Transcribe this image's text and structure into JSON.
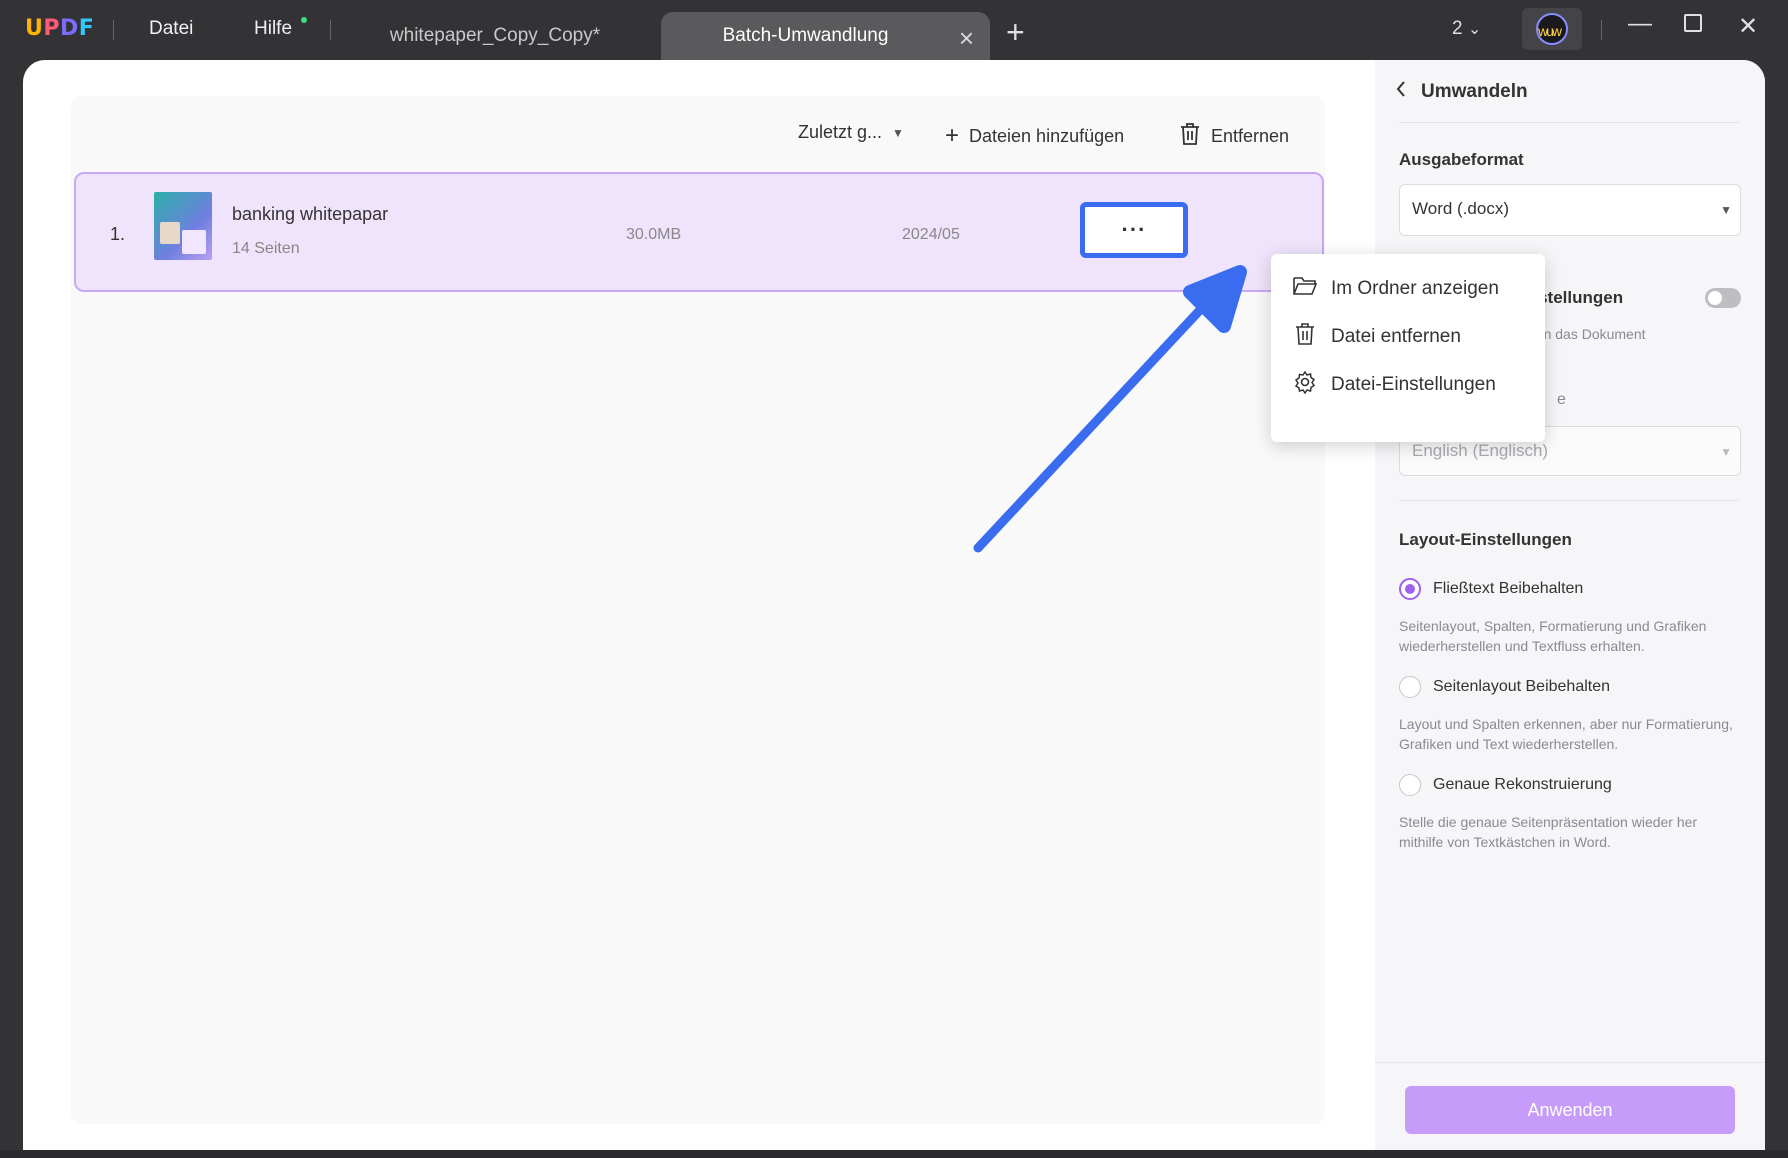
{
  "titlebar": {
    "logo": "UPDF",
    "menus": [
      "Datei",
      "Hilfe"
    ],
    "tabs": [
      {
        "label": "whitepaper_Copy_Copy*"
      },
      {
        "label": "Batch-Umwandlung"
      }
    ],
    "window_count": "2"
  },
  "toolbar": {
    "sort_label": "Zuletzt g...",
    "add_label": "Dateien hinzufügen",
    "remove_label": "Entfernen"
  },
  "file": {
    "index": "1.",
    "name": "banking whitepapar",
    "pages": "14 Seiten",
    "size": "30.0MB",
    "date": "2024/05",
    "more": "···"
  },
  "context_menu": {
    "items": [
      "Im Ordner anzeigen",
      "Datei entfernen",
      "Datei-Einstellungen"
    ]
  },
  "right_panel": {
    "header": "Umwandeln",
    "output_format_title": "Ausgabeformat",
    "output_format_value": "Word (.docx)",
    "partial_title": "instellungen",
    "partial_desc": "venn das Dokument",
    "partial_label": "e",
    "language_value": "English (Englisch)",
    "layout_title": "Layout-Einstellungen",
    "options": [
      {
        "label": "Fließtext Beibehalten",
        "desc": "Seitenlayout, Spalten, Formatierung und Grafiken wiederherstellen und Textfluss erhalten."
      },
      {
        "label": "Seitenlayout Beibehalten",
        "desc": "Layout und Spalten erkennen, aber nur Formatierung, Grafiken und Text wiederherstellen."
      },
      {
        "label": "Genaue Rekonstruierung",
        "desc": "Stelle die genaue Seitenpräsentation wieder her mithilfe von Textkästchen in Word."
      }
    ],
    "apply_label": "Anwenden"
  },
  "colors": {
    "accent": "#a060f0",
    "highlight_blue": "#3a6cf0",
    "apply_button": "#c79bfa",
    "row_bg": "#efe4fb"
  },
  "icons": [
    "chevron-left-icon",
    "plus-icon",
    "trash-icon",
    "folder-open-icon",
    "gear-icon",
    "close-icon",
    "minimize-icon",
    "maximize-icon",
    "chevron-down-icon"
  ]
}
